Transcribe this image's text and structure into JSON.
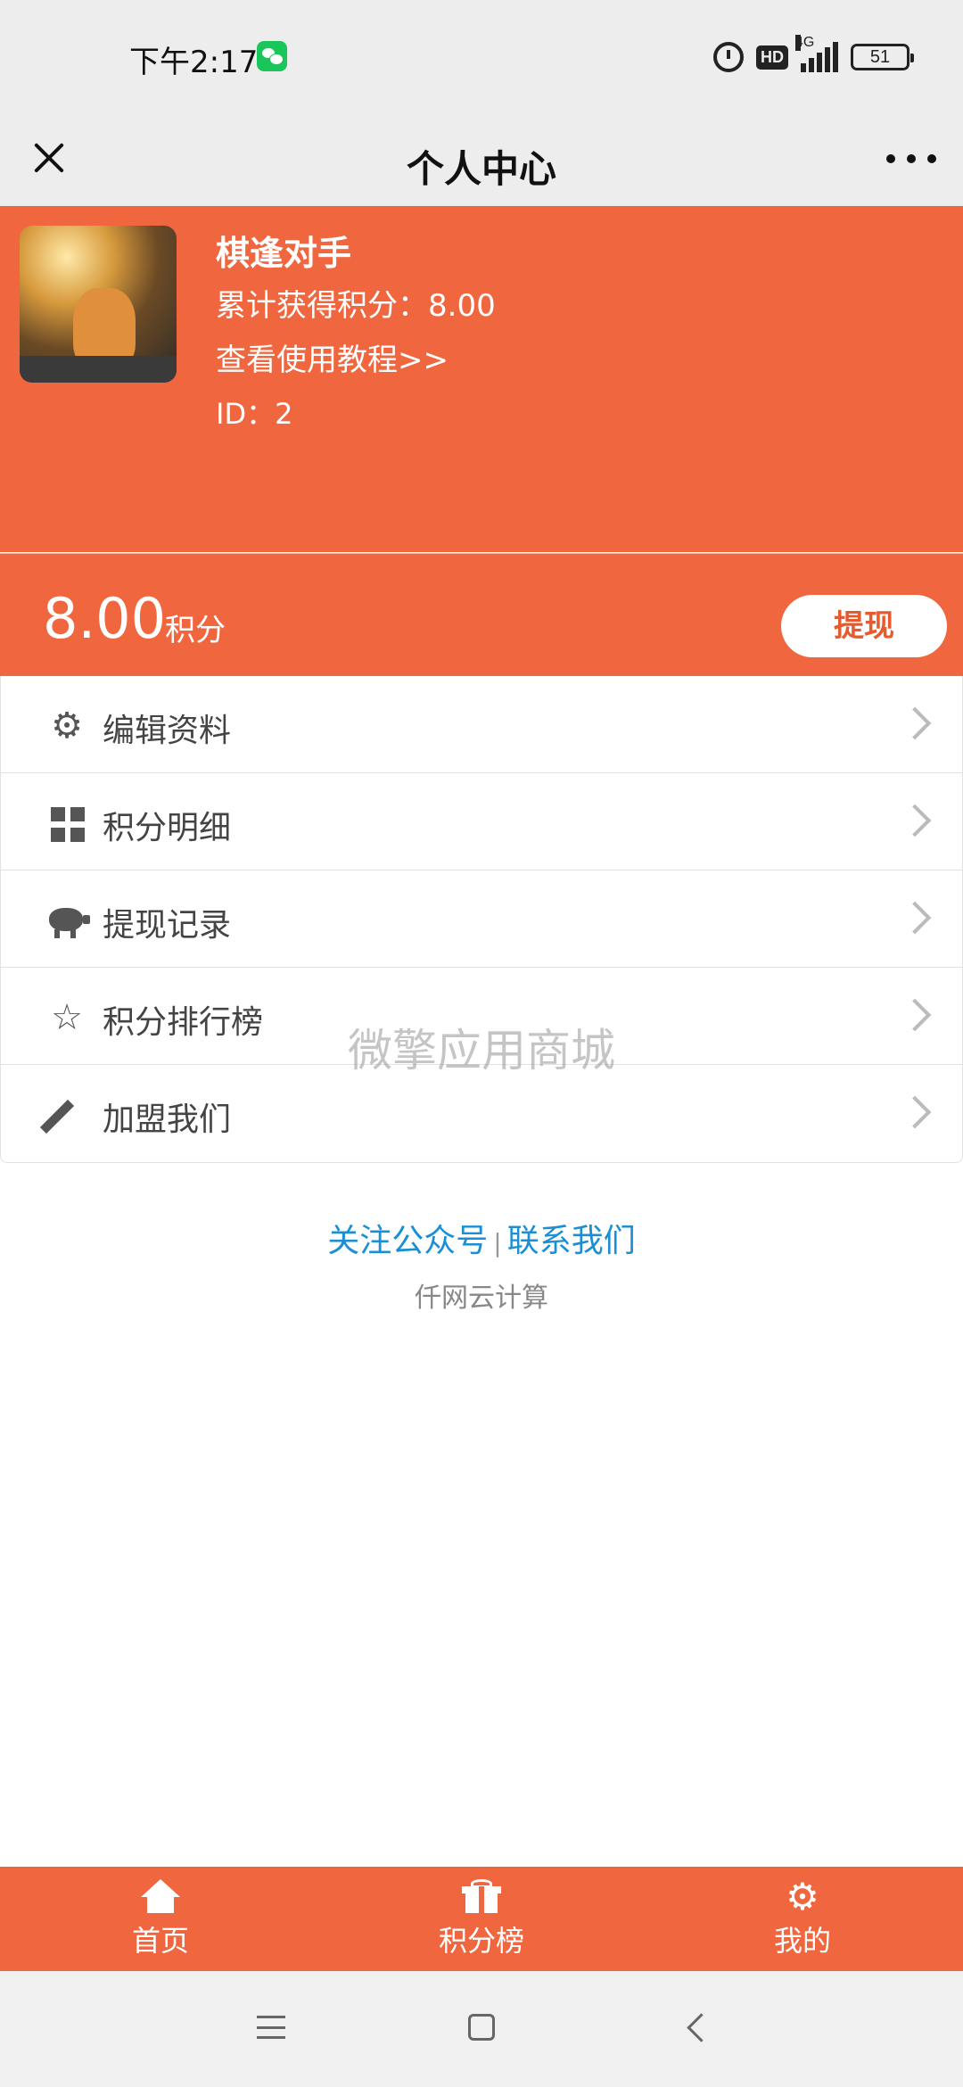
{
  "status_bar": {
    "time": "下午2:17",
    "network": "4G",
    "hd": "HD",
    "battery": "51"
  },
  "title_bar": {
    "title": "个人中心"
  },
  "profile": {
    "name": "棋逢对手",
    "total_points": "累计获得积分：8.00",
    "tutorial_link": "查看使用教程>>",
    "id": "ID：2"
  },
  "balance": {
    "value": "8.00",
    "unit": "积分",
    "withdraw_label": "提现"
  },
  "menu": {
    "items": [
      {
        "label": "编辑资料",
        "icon": "gear-icon"
      },
      {
        "label": "积分明细",
        "icon": "grid-icon"
      },
      {
        "label": "提现记录",
        "icon": "piggy-bank-icon"
      },
      {
        "label": "积分排行榜",
        "icon": "star-icon"
      },
      {
        "label": "加盟我们",
        "icon": "pencil-icon"
      }
    ]
  },
  "watermark": "微擎应用商城",
  "footer": {
    "follow_label": "关注公众号",
    "separator": "|",
    "contact_label": "联系我们",
    "company": "仟网云计算"
  },
  "tabbar": {
    "items": [
      {
        "label": "首页",
        "icon": "home-icon"
      },
      {
        "label": "积分榜",
        "icon": "gift-icon"
      },
      {
        "label": "我的",
        "icon": "gear-icon"
      }
    ]
  },
  "colors": {
    "accent": "#f0673f",
    "link": "#1a8fd6"
  }
}
